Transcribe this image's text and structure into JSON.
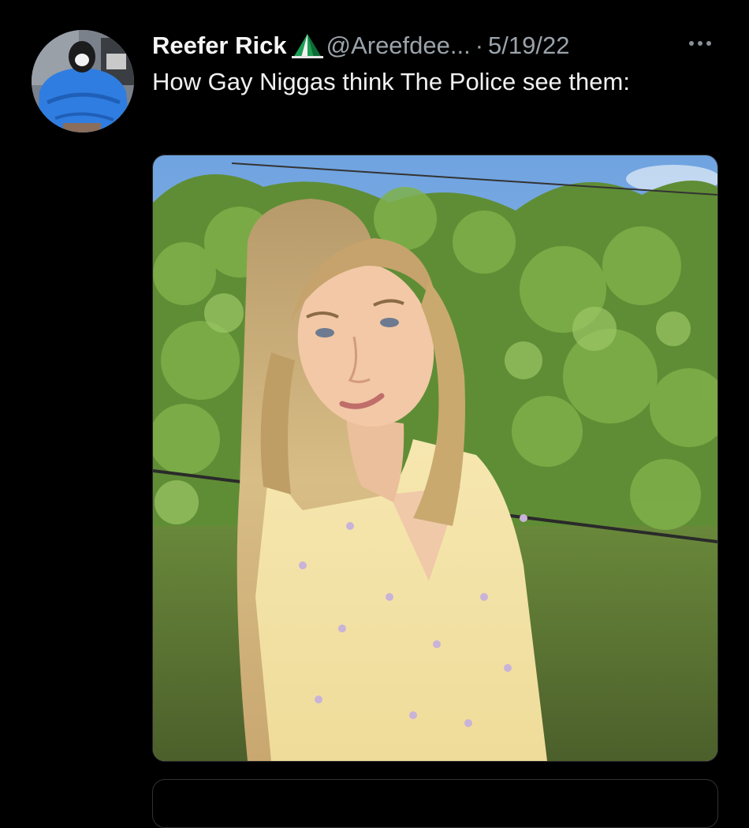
{
  "tweet": {
    "author": {
      "display_name": "Reefer Rick",
      "badge_icon": "flag-emoji-icon",
      "handle": "@Areefdee...",
      "separator": "·",
      "date": "5/19/22"
    },
    "text": "How Gay Niggas think The Police see them:",
    "media": {
      "type": "photo"
    },
    "more_icon": "more-dots-icon"
  },
  "colors": {
    "background": "#000000",
    "text": "#f1f1f1",
    "secondary": "#9ba3ab"
  }
}
